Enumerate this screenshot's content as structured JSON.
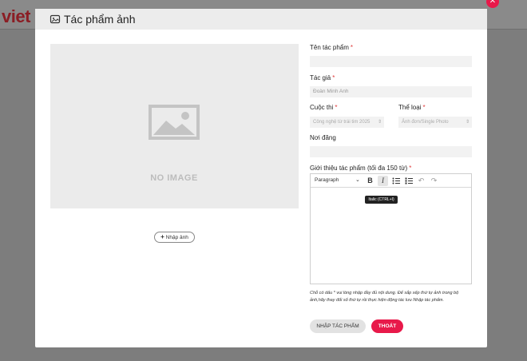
{
  "background": {
    "logo": "viet"
  },
  "modal": {
    "title": "Tác phẩm ảnh",
    "no_image_text": "NO IMAGE",
    "upload_button": "Nhập ảnh",
    "fields": {
      "work_name": {
        "label": "Tên tác phẩm",
        "required": "*",
        "value": ""
      },
      "author": {
        "label": "Tác giả",
        "required": "*",
        "value": "Đoàn Minh Anh"
      },
      "contest": {
        "label": "Cuộc thi",
        "required": "*",
        "value": "Công nghệ từ trái tim 2025"
      },
      "category": {
        "label": "Thể loại",
        "required": "*",
        "value": "Ảnh đơn/Single Photo"
      },
      "location": {
        "label": "Nơi đăng",
        "value": ""
      },
      "description": {
        "label": "Giới thiệu tác phẩm (tối đa 150 từ)",
        "required": "*"
      }
    },
    "editor": {
      "paragraph": "Paragraph",
      "bold": "B",
      "italic": "I",
      "tooltip": "Italic (CTRL+I)"
    },
    "note": "Chỗ có dấu * vui lòng nhập đầy đủ nội dung. Để sắp xếp thứ tự ảnh trong bộ ảnh,hãy thay đổi số thứ tự rồi thực hiện động tác lưu Nhập tác phẩm.",
    "buttons": {
      "save": "NHẬP TÁC PHẨM",
      "exit": "THOÁT"
    },
    "colors": {
      "accent": "#e8194a",
      "logo": "#8b1d24"
    }
  }
}
